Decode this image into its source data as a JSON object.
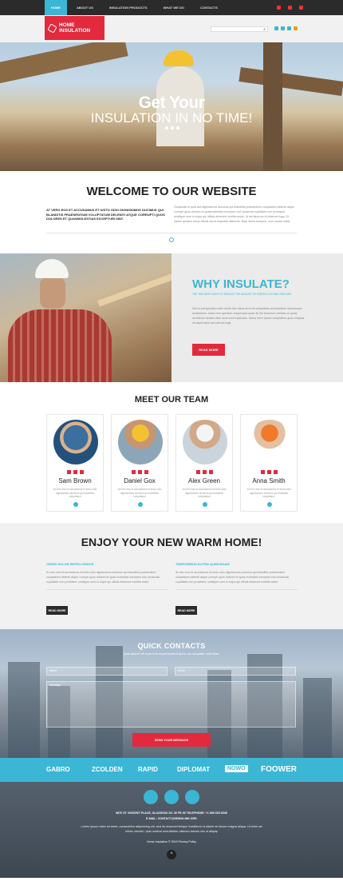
{
  "nav": {
    "items": [
      "Home",
      "About us",
      "Insulation products",
      "What we do",
      "Contacts"
    ]
  },
  "logo": {
    "line1": "Home",
    "line2": "Insulation"
  },
  "search": {
    "placeholder": ""
  },
  "hero": {
    "title": "Get Your",
    "subtitle": "INSULATION IN NO TIME!"
  },
  "welcome": {
    "title": "WELCOME TO OUR WEBSITE",
    "left_text": "AT VERO EOS ET ACCUSAMUS ET IUSTO ODIO DIGNISSIMOS DUCIMUS QUI BLANDITIS PRAESENTIUM VOLUPTATUM DELENITI ATQUE CORRUPTI QUOS DOLORES ET QUASMOLESTIAS EXCEPTURI SINT.",
    "right_text": "Occaecati et quia sint dignissimos ducimus qui blanditiis praesentium voluptatum deleniti atque corrupti quos dolores et quasmolestias excepturi sint occaecati cupiditate non provident, similique sunt in culpa qui officia deserunt mollitia animi, id est laborum et dolorum fuga. Et harum quidem rerum facilis est et expedita distinctio. Nam libero tempore, cum soluta nobis."
  },
  "why": {
    "title": "WHY INSULATE?",
    "subtitle": "The two best ways to reduce the amount of energy a home uses are",
    "body": "Sed ut perspiciatis unde omnis iste natus error sit voluptatem accusantium doloremque laudantium, totam rem aperiam, eaque ipsa quae ab illo inventore veritatis et quasi architecto beatae vitae dicta sunt explicabo. Nemo enim ipsam voluptatem quia voluptas sit aspernatur aut odit aut fugit.",
    "button": "Read more"
  },
  "team": {
    "title": "MEET OUR TEAM",
    "members": [
      {
        "name": "Sam Brown",
        "desc": "At vero eos et accusamus et iusto odio dignissimos ducimus qui blanditiis voluptatum"
      },
      {
        "name": "Daniel Gox",
        "desc": "At vero eos et accusamus et iusto odio dignissimos ducimus qui blanditiis voluptatum"
      },
      {
        "name": "Alex Green",
        "desc": "At vero eos et accusamus et iusto odio dignissimos ducimus qui blanditiis voluptatum"
      },
      {
        "name": "Anna Smith",
        "desc": "At vero eos et accusamus et iusto odio dignissimos ducimus qui blanditiis voluptatum"
      }
    ]
  },
  "warm": {
    "title": "ENJOY YOUR NEW WARM HOME!",
    "col1_title": "Omnis dolor repellendus",
    "col1_body": "At vero eos et accusamus et iusto odio dignissimos ducimus qui blanditiis praesentium voluptatum deleniti atque corrupti quos dolores et quas molestias excepturi sint occaecati cupiditate non provident, similique sunt in culpa qui officia deserunt mollitia animi.",
    "col2_title": "Temporibus autem quibusdam",
    "col2_body": "At vero eos et accusamus et iusto odio dignissimos ducimus qui blanditiis praesentium voluptatum deleniti atque corrupti quos dolores et quas molestias excepturi sint occaecati cupiditate non provident, similique sunt in culpa qui officia deserunt mollitia animi.",
    "button": "Read more"
  },
  "contacts": {
    "title": "QUICK CONTACTS",
    "subtitle": "Quis autem vel eum iure reprehenderit qui in ea voluptate velit esse.",
    "name_placeholder": "Name",
    "email_placeholder": "Email",
    "message_placeholder": "Message",
    "button": "Send your message"
  },
  "clients": [
    "GABRO",
    "ZCOLDEN",
    "RAPID",
    "DIPLOMAT",
    "NOWO",
    "FOOWER"
  ],
  "footer": {
    "address": "9870 St Vincent Place, Glasgow, DC 45 Fr 45  Telephone: +1 800 603 6035",
    "email": "E-mail: contact@demolink.org",
    "body": "Lorem ipsum dolor sit amet, consectetur adipisicing elit, sed do eiusmod tempor incididunt ut labore et dolore magna aliqua. Ut enim ad minim veniam, quis nostrud exercitation ullamco laboris nisi ut aliquip",
    "copyright": "Home Insulation © 2015 Privacy Policy"
  },
  "colors": {
    "accent": "#3bb6d4",
    "brand": "#e3293c",
    "dark": "#2b2b2b"
  }
}
